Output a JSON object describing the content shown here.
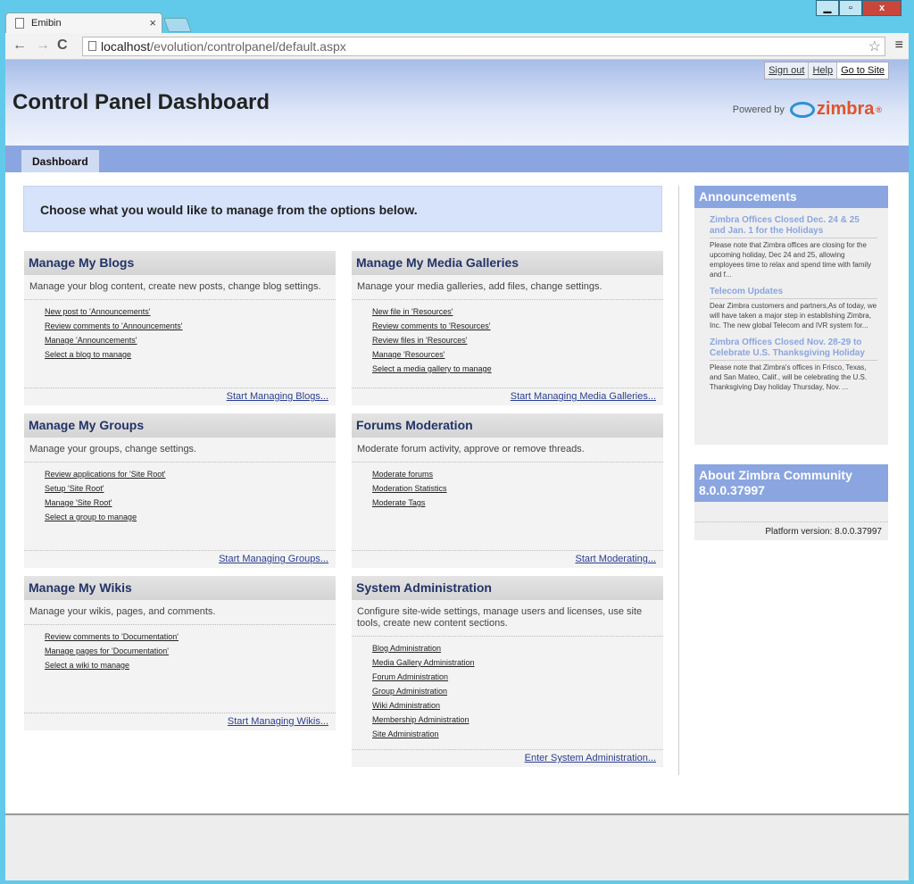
{
  "browser": {
    "tab_title": "Emibin",
    "tab_close": "×",
    "url_host": "localhost",
    "url_path": "/evolution/controlpanel/default.aspx",
    "back": "←",
    "forward": "→",
    "reload": "C",
    "star": "☆",
    "menu": "≡",
    "min": "▁",
    "max": "▫",
    "close": "x"
  },
  "header": {
    "signout": "Sign out",
    "help": "Help",
    "goto_site": "Go to Site",
    "title": "Control Panel Dashboard",
    "powered_by": "Powered by",
    "brand": "zimbra",
    "brand_reg": "®"
  },
  "nav": {
    "dashboard": "Dashboard"
  },
  "intro": "Choose what you would like to manage from the options below.",
  "cards": [
    {
      "title": "Manage My Blogs",
      "desc": "Manage your blog content, create new posts, change blog settings.",
      "links": [
        "New post to 'Announcements'",
        "Review comments to 'Announcements'",
        "Manage 'Announcements'",
        "Select a blog to manage"
      ],
      "footer": "Start Managing Blogs..."
    },
    {
      "title": "Manage My Media Galleries",
      "desc": "Manage your media galleries, add files, change settings.",
      "links": [
        "New file in 'Resources'",
        "Review comments to 'Resources'",
        "Review files in 'Resources'",
        "Manage 'Resources'",
        "Select a media gallery to manage"
      ],
      "footer": "Start Managing Media Galleries..."
    },
    {
      "title": "Manage My Groups",
      "desc": "Manage your groups, change settings.",
      "links": [
        "Review applications for 'Site Root'",
        "Setup 'Site Root'",
        "Manage 'Site Root'",
        "Select a group to manage"
      ],
      "footer": "Start Managing Groups..."
    },
    {
      "title": "Forums Moderation",
      "desc": "Moderate forum activity, approve or remove threads.",
      "links": [
        "Moderate forums",
        "Moderation Statistics",
        "Moderate Tags"
      ],
      "footer": "Start Moderating..."
    },
    {
      "title": "Manage My Wikis",
      "desc": "Manage your wikis, pages, and comments.",
      "links": [
        "Review comments to 'Documentation'",
        "Manage pages for 'Documentation'",
        "Select a wiki to manage"
      ],
      "footer": "Start Managing Wikis..."
    },
    {
      "title": "System Administration",
      "desc": "Configure site-wide settings, manage users and licenses, use site tools, create new content sections.",
      "links": [
        "Blog Administration",
        "Media Gallery Administration",
        "Forum Administration",
        "Group Administration",
        "Wiki Administration",
        "Membership Administration",
        "Site Administration"
      ],
      "footer": "Enter System Administration..."
    }
  ],
  "announcements": {
    "title": "Announcements",
    "items": [
      {
        "title": "Zimbra Offices Closed Dec. 24 & 25 and Jan. 1 for the Holidays",
        "body": "Please note that Zimbra offices are closing for the upcoming holiday, Dec 24 and 25, allowing employees time to relax and spend time with family and f..."
      },
      {
        "title": "Telecom Updates",
        "body": "Dear Zimbra customers and partners,As of today, we will have taken a major step in establishing Zimbra, Inc. The new global Telecom and IVR system for..."
      },
      {
        "title": "Zimbra Offices Closed Nov. 28-29 to Celebrate U.S. Thanksgiving Holiday",
        "body": "Please note that Zimbra's offices in Frisco, Texas, and San Mateo, Calif., will be celebrating the U.S. Thanksgiving Day holiday Thursday, Nov. ..."
      }
    ]
  },
  "about": {
    "title": "About Zimbra Community 8.0.0.37997",
    "platform": "Platform version: 8.0.0.37997"
  }
}
